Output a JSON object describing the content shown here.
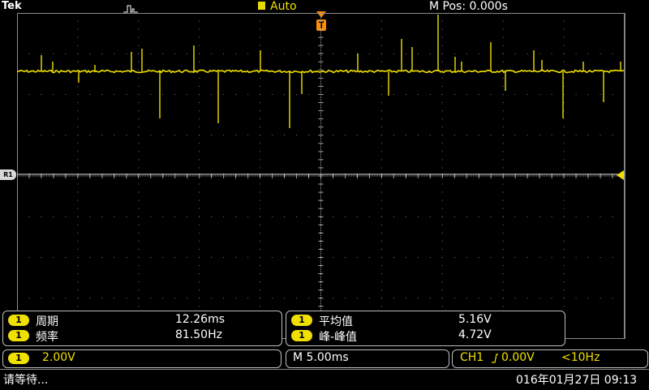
{
  "header": {
    "brand": "Tek",
    "trigger_state_icon": "pulse-step-icon",
    "trigger_mode": "Auto",
    "m_pos": "M Pos: 0.000s"
  },
  "screen": {
    "trace_color": "#f0e000",
    "reference_label": "R1",
    "trigger_position_icon": "trigger-position-t-icon",
    "trigger_level_icon": "trigger-level-arrow-icon"
  },
  "measurements": {
    "left": [
      {
        "channel": "1",
        "label": "周期",
        "value": "12.26ms"
      },
      {
        "channel": "1",
        "label": "频率",
        "value": "81.50Hz"
      }
    ],
    "right": [
      {
        "channel": "1",
        "label": "平均值",
        "value": "5.16V"
      },
      {
        "channel": "1",
        "label": "峰-峰值",
        "value": "4.72V"
      }
    ]
  },
  "bottom": {
    "channel": "1",
    "channel_scale": "2.00V",
    "timebase": "M 5.00ms",
    "trigger_source": "CH1",
    "trigger_slope_icon": "rising-edge-icon",
    "trigger_level": "0.00V",
    "trigger_freq": "<10Hz"
  },
  "status": {
    "message": "请等待...",
    "datetime": "016年01月27日 09:13"
  }
}
